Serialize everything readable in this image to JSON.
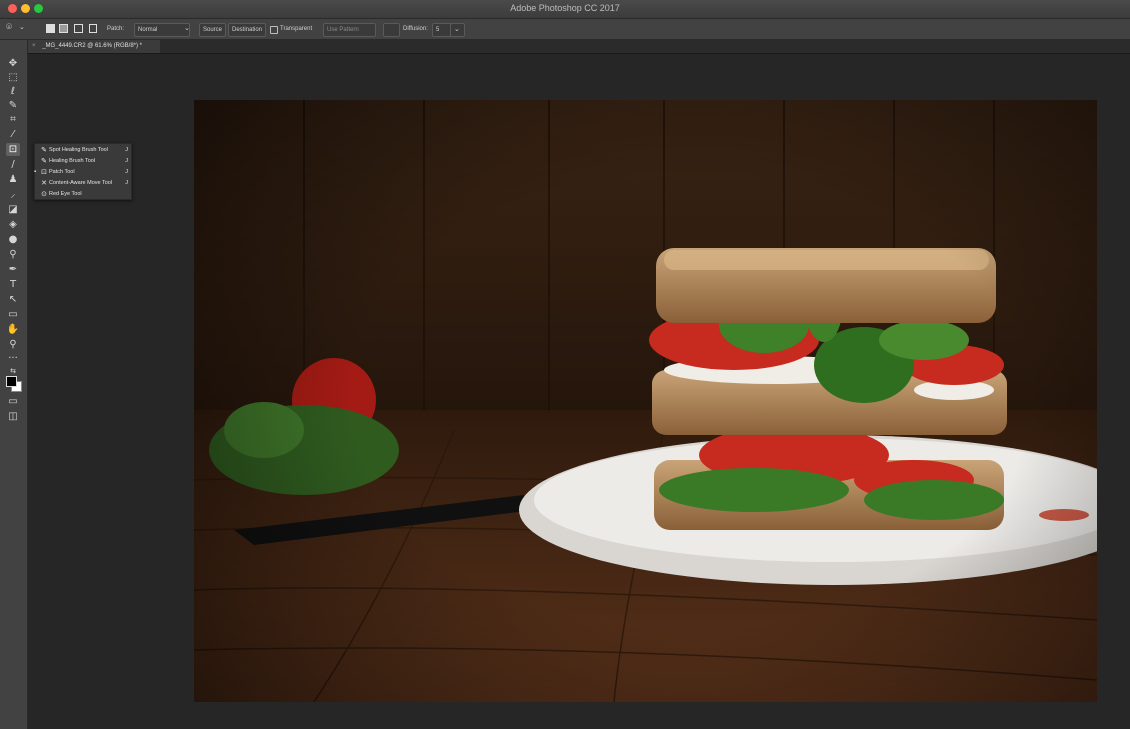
{
  "window": {
    "title": "Adobe Photoshop CC 2017"
  },
  "options_bar": {
    "patch_label": "Patch:",
    "patch_value": "Normal",
    "source_label": "Source",
    "destination_label": "Destination",
    "transparent_label": "Transparent",
    "use_pattern_label": "Use Pattern",
    "diffusion_label": "Diffusion:",
    "diffusion_value": "5"
  },
  "document": {
    "tab_label": "_MG_4449.CR2 @ 61.6% (RGB/8*) *",
    "close_glyph": "×"
  },
  "flyout": {
    "items": [
      {
        "label": "Spot Healing Brush Tool",
        "shortcut": "J",
        "icon": "spot-healing-icon"
      },
      {
        "label": "Healing Brush Tool",
        "shortcut": "J",
        "icon": "healing-brush-icon"
      },
      {
        "label": "Patch Tool",
        "shortcut": "J",
        "icon": "patch-icon",
        "selected": true
      },
      {
        "label": "Content-Aware Move Tool",
        "shortcut": "J",
        "icon": "content-aware-move-icon"
      },
      {
        "label": "Red Eye Tool",
        "shortcut": "J",
        "icon": "red-eye-icon"
      }
    ]
  },
  "tools": [
    "move-icon",
    "marquee-icon",
    "lasso-icon",
    "quick-select-icon",
    "crop-icon",
    "eyedropper-icon",
    "patch-icon",
    "brush-icon",
    "stamp-icon",
    "history-brush-icon",
    "eraser-icon",
    "paint-bucket-icon",
    "blur-icon",
    "dodge-icon",
    "pen-icon",
    "type-icon",
    "path-select-icon",
    "rectangle-icon",
    "hand-icon",
    "zoom-icon",
    "more-icon",
    "swap-colors-icon",
    "color-swatches-icon",
    "quick-mask-icon",
    "screen-mode-icon"
  ],
  "colors": {
    "accent": "#fe5f57",
    "panel": "#424242",
    "canvas_bg": "#262626"
  }
}
